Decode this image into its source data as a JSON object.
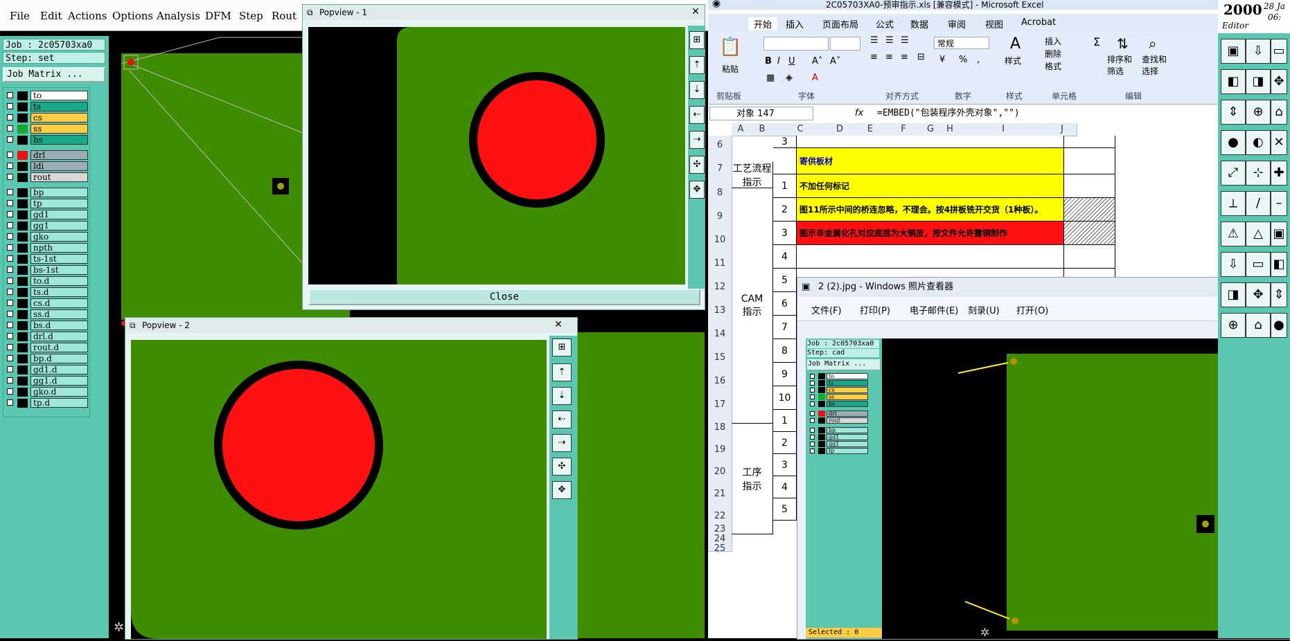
{
  "cam": {
    "menu": [
      "File",
      "Edit",
      "Actions",
      "Options",
      "Analysis",
      "DFM",
      "Step",
      "Rout"
    ],
    "job_label": "Job : 2c05703xa0",
    "step_label": "Step: set",
    "job_matrix": "Job Matrix ...",
    "layers": [
      {
        "name": "to",
        "color": "#ffffff",
        "swatch": "#000000"
      },
      {
        "name": "ts",
        "color": "#1aa888",
        "swatch": "#000000"
      },
      {
        "name": "cs",
        "color": "#ffcc44",
        "swatch": "#000000"
      },
      {
        "name": "ss",
        "color": "#ffcc44",
        "swatch": "#1aa830"
      },
      {
        "name": "bs",
        "color": "#1aa888",
        "swatch": "#000000"
      },
      {
        "name": "drl",
        "color": "#9aaeb8",
        "swatch": "#ee1111",
        "mark": "drill-active"
      },
      {
        "name": "ldi",
        "color": "#9aaeb8",
        "swatch": "#000000"
      },
      {
        "name": "rout",
        "color": "#d8d8d8",
        "swatch": "#000000"
      },
      {
        "name": "bp",
        "color": "#9ee6da",
        "swatch": "#000000"
      },
      {
        "name": "tp",
        "color": "#9ee6da",
        "swatch": "#000000"
      },
      {
        "name": "gd1",
        "color": "#9ee6da",
        "swatch": "#000000"
      },
      {
        "name": "gg1",
        "color": "#9ee6da",
        "swatch": "#000000"
      },
      {
        "name": "gko",
        "color": "#9ee6da",
        "swatch": "#000000"
      },
      {
        "name": "npth",
        "color": "#9ee6da",
        "swatch": "#000000"
      },
      {
        "name": "ts-1st",
        "color": "#9ee6da",
        "swatch": "#000000"
      },
      {
        "name": "bs-1st",
        "color": "#9ee6da",
        "swatch": "#000000"
      },
      {
        "name": "to.d",
        "color": "#9ee6da",
        "swatch": "#000000"
      },
      {
        "name": "ts.d",
        "color": "#9ee6da",
        "swatch": "#000000"
      },
      {
        "name": "cs.d",
        "color": "#9ee6da",
        "swatch": "#000000"
      },
      {
        "name": "ss.d",
        "color": "#9ee6da",
        "swatch": "#000000"
      },
      {
        "name": "bs.d",
        "color": "#9ee6da",
        "swatch": "#000000"
      },
      {
        "name": "drl.d",
        "color": "#9ee6da",
        "swatch": "#000000"
      },
      {
        "name": "rout.d",
        "color": "#9ee6da",
        "swatch": "#000000"
      },
      {
        "name": "bp.d",
        "color": "#9ee6da",
        "swatch": "#000000"
      },
      {
        "name": "gd1.d",
        "color": "#9ee6da",
        "swatch": "#000000"
      },
      {
        "name": "gg1.d",
        "color": "#9ee6da",
        "swatch": "#000000"
      },
      {
        "name": "gko.d",
        "color": "#9ee6da",
        "swatch": "#000000"
      },
      {
        "name": "tp.d",
        "color": "#9ee6da",
        "swatch": "#000000"
      }
    ],
    "popview1": {
      "title": "Popview - 1",
      "close": "Close"
    },
    "popview2": {
      "title": "Popview - 2"
    }
  },
  "excel": {
    "title": "2C05703XA0-预审指示.xls [兼容模式] - Microsoft Excel",
    "tabs": [
      "开始",
      "插入",
      "页面布局",
      "公式",
      "数据",
      "审阅",
      "视图",
      "Acrobat"
    ],
    "groups": [
      "剪贴板",
      "字体",
      "对齐方式",
      "数字",
      "样式",
      "单元格",
      "编辑"
    ],
    "paste": "粘贴",
    "number_format": "常规",
    "style_btn": "样式",
    "insert": "插入",
    "delete": "删除",
    "format": "格式",
    "sort": "排序和\n筛选",
    "find": "查找和\n选择",
    "name_box": "对象 147",
    "formula": "=EMBED(\"包装程序外壳对象\",\"\")",
    "columns": [
      "A",
      "B",
      "C",
      "D",
      "E",
      "F",
      "G",
      "H",
      "I",
      "J"
    ],
    "rows": [
      {
        "num": "6",
        "b": "3"
      },
      {
        "num": "7",
        "a": "工艺流程\n指示",
        "c": "寄供板材"
      },
      {
        "num": "8",
        "b": "1",
        "c": "不加任何标记"
      },
      {
        "num": "9",
        "b": "2",
        "c": "图11所示中间的桥连忽略，不理会。按4拼板铣开交货（1种板）。"
      },
      {
        "num": "10",
        "b": "3",
        "c": "图示非金属化孔对应底层为大铜皮，按文件允许露铜制作"
      },
      {
        "num": "11",
        "b": "4"
      },
      {
        "num": "12",
        "b": "5",
        "a": "CAM\n指示"
      },
      {
        "num": "13",
        "b": "6"
      },
      {
        "num": "14",
        "b": "7"
      },
      {
        "num": "15",
        "b": "8"
      },
      {
        "num": "16",
        "b": "9"
      },
      {
        "num": "17",
        "b": "10"
      },
      {
        "num": "18",
        "b": "1"
      },
      {
        "num": "19",
        "b": "2"
      },
      {
        "num": "20",
        "b": "3",
        "a": "工序\n指示"
      },
      {
        "num": "21",
        "b": "4"
      },
      {
        "num": "22",
        "b": "5"
      },
      {
        "num": "23"
      },
      {
        "num": "24"
      },
      {
        "num": "25"
      }
    ]
  },
  "viewer": {
    "title": "2 (2).jpg - Windows 照片查看器",
    "menu": [
      "文件(F)",
      "打印(P)",
      "电子邮件(E)",
      "刻录(U)",
      "打开(O)"
    ],
    "inner_job": "Job : 2c05703xa0",
    "inner_step": "Step: cad",
    "inner_matrix": "Job Matrix ...",
    "inner_layers": [
      "to",
      "ts",
      "cs",
      "ss",
      "bs",
      "drl",
      "rout",
      "bp",
      "gd1",
      "gg1",
      "tp"
    ],
    "selected": "Selected : 0"
  },
  "right_tool": {
    "year": "2000",
    "date": "28 Ja",
    "time": "06:",
    "label": "Editor"
  }
}
